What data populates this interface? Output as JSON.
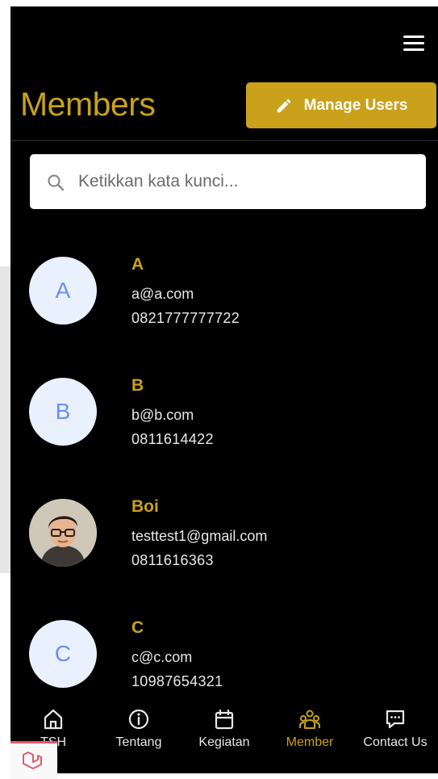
{
  "header": {
    "title": "Members",
    "manage_label": "Manage Users"
  },
  "search": {
    "placeholder": "Ketikkan kata kunci..."
  },
  "members": [
    {
      "initial": "A",
      "name": "A",
      "email": "a@a.com",
      "phone": "0821777777722",
      "has_photo": false
    },
    {
      "initial": "B",
      "name": "B",
      "email": "b@b.com",
      "phone": "0811614422",
      "has_photo": false
    },
    {
      "initial": "",
      "name": "Boi",
      "email": "testtest1@gmail.com",
      "phone": "0811616363",
      "has_photo": true
    },
    {
      "initial": "C",
      "name": "C",
      "email": "c@c.com",
      "phone": "10987654321",
      "has_photo": false
    }
  ],
  "nav": [
    {
      "label": "TSH",
      "icon": "home-icon"
    },
    {
      "label": "Tentang",
      "icon": "info-icon"
    },
    {
      "label": "Kegiatan",
      "icon": "calendar-icon"
    },
    {
      "label": "Member",
      "icon": "group-icon",
      "active": true
    },
    {
      "label": "Contact Us",
      "icon": "chat-icon"
    }
  ],
  "colors": {
    "accent": "#c9a11a",
    "background": "#000000",
    "avatar_bg": "#e8f1fd",
    "avatar_text": "#6f8ef3"
  }
}
